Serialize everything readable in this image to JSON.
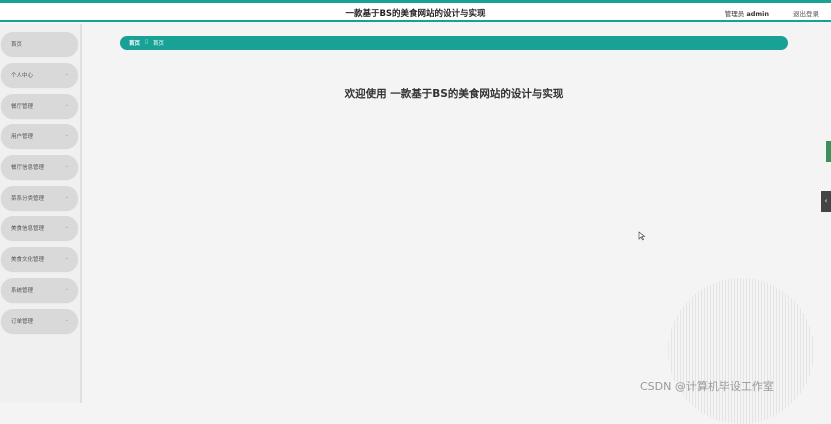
{
  "header": {
    "title": "一款基于BS的美食网站的设计与实现",
    "role": "管理员",
    "username": "admin",
    "logout_label": "退出登录"
  },
  "sidebar": {
    "items": [
      {
        "label": "首页"
      },
      {
        "label": "个人中心"
      },
      {
        "label": "餐厅管理"
      },
      {
        "label": "用户管理"
      },
      {
        "label": "餐厅信息管理"
      },
      {
        "label": "菜系分类管理"
      },
      {
        "label": "美食信息管理"
      },
      {
        "label": "美食文化管理"
      },
      {
        "label": "系统管理"
      },
      {
        "label": "订单管理"
      }
    ]
  },
  "breadcrumb": {
    "home": "首页",
    "separator": "▯",
    "current": "首页"
  },
  "main": {
    "welcome": "欢迎使用 一款基于BS的美食网站的设计与实现"
  },
  "watermark": "CSDN @计算机毕设工作室",
  "colors": {
    "accent": "#18a195",
    "sidebar_item": "#d9d9d9",
    "background": "#f4f4f4"
  }
}
